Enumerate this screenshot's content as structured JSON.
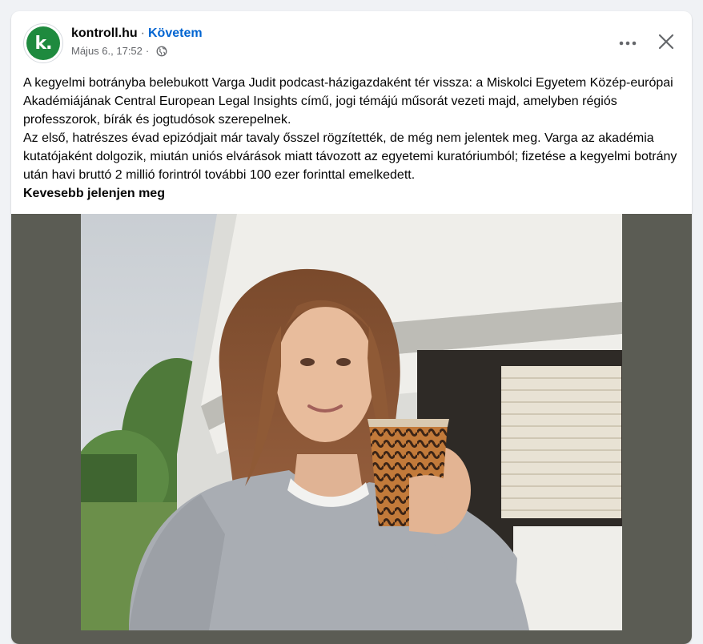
{
  "post": {
    "page_name": "kontroll.hu",
    "separator": "·",
    "follow_label": "Követem",
    "timestamp": "Május 6., 17:52",
    "separator2": "·",
    "avatar_letter": "k.",
    "more_label": "•••",
    "paragraph1": "A kegyelmi botrányba belebukott Varga Judit podcast-házigazdaként tér vissza: a Miskolci Egyetem Közép-európai Akadémiájának Central European Legal Insights című, jogi témájú műsorát vezeti majd, amelyben régiós professzorok, bírák és jogtudósok szerepelnek.",
    "paragraph2": "Az első, hatrészes évad epizódjait már tavaly ősszel rögzítették, de még nem jelentek meg. Varga az akadémia kutatójaként dolgozik, miután uniós elvárások miatt távozott az egyetemi kuratóriumból; fizetése a kegyelmi botrány után havi bruttó 2 millió forintról további 100 ezer forinttal emelkedett.",
    "see_less_label": "Kevesebb jelenjen meg"
  },
  "colors": {
    "follow": "#0064d1",
    "avatar_green": "#1e8a3e",
    "secondary_text": "#65676b",
    "photo_frame": "#5b5c54"
  },
  "icons": [
    "globe-icon",
    "more-icon",
    "close-icon"
  ]
}
